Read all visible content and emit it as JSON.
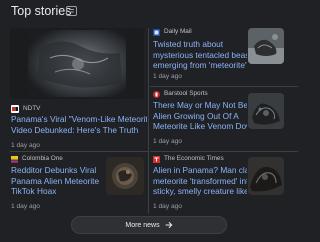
{
  "section": {
    "title": "Top stories"
  },
  "stories": [
    {
      "source": "NDTV",
      "headline_lines": [
        "Panama's Viral \"Venom-Like Meteorite\"",
        "Video Debunked: Here's The Truth"
      ],
      "age": "1 day ago"
    },
    {
      "source": "Daily Mail",
      "headline_lines": [
        "Twisted truth about",
        "mysterious tentacled beast",
        "emerging from 'meteorite'"
      ],
      "age": "1 day ago"
    },
    {
      "source": "Barstool Sports",
      "headline_lines": [
        "There May or May Not Be An",
        "Alien Growing Out Of A",
        "Meteorite Like Venom Down..."
      ],
      "age": "1 day ago"
    },
    {
      "source": "Colombia One",
      "headline_lines": [
        "Redditor Debunks Viral",
        "Panama Alien Meteorite",
        "TikTok Hoax"
      ],
      "age": "1 day ago"
    },
    {
      "source": "The Economic Times",
      "headline_lines": [
        "Alien in Panama? Man claims",
        "meteorite 'transformed' into",
        "sticky, smelly creature like..."
      ],
      "age": "1 day ago"
    }
  ],
  "more_news": {
    "label": "More news",
    "icon": "arrow-right-icon"
  },
  "colors": {
    "background": "#202124",
    "headline": "#8ab4f8",
    "text": "#e8eaed",
    "muted": "#9aa0a6",
    "divider": "#3c4043"
  }
}
